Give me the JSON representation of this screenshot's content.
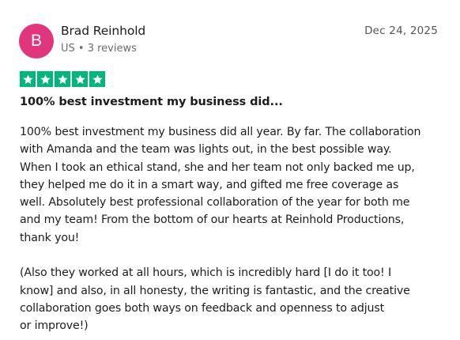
{
  "reviewer": {
    "initial": "B",
    "name": "Brad Reinhold",
    "meta": "US • 3 reviews",
    "avatar_color": "#e1357e"
  },
  "date": "Dec 24, 2025",
  "rating": {
    "stars": 5,
    "max": 5,
    "color": "#00b67a",
    "icon": "star-icon"
  },
  "title": "100% best investment my business did...",
  "body": {
    "paragraph_1_lines": [
      "100% best investment my business did all year. By far. The collaboration",
      "with Amanda and the team was lights out, in the best possible way.",
      "When I took an ethical stand, she and her team not only backed me up,",
      "they helped me do it in a smart way, and gifted me free coverage as",
      "well. Absolutely best professional collaboration of the year for both me",
      "and my team! From the bottom of our hearts at Reinhold Productions,",
      "thank you!"
    ],
    "paragraph_2_lines": [
      "(Also they worked at all hours, which is incredibly hard [I do it too! I",
      "know] and also, in all honesty, the writing is fantastic, and the creative",
      "collaboration goes both ways on feedback and openness to adjust",
      "or improve!)"
    ]
  }
}
